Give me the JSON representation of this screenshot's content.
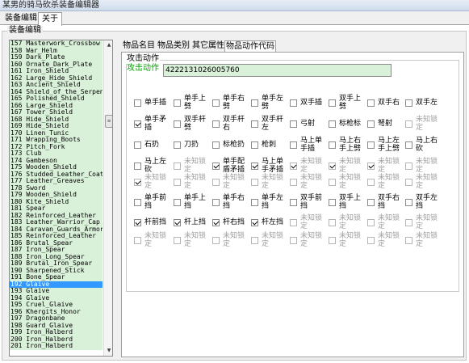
{
  "window": {
    "title": "某男的骑马砍杀装备编辑器"
  },
  "menu": {
    "items": [
      "装备编辑",
      "关于"
    ]
  },
  "equipment_group": {
    "label": "装备编辑"
  },
  "item_list": {
    "selected_index": 35,
    "items": [
      "157 Masterwork_Crossbow",
      "158 War_Helm",
      "159 Dark_Plate",
      "160 Ornate_Dark_Plate",
      "161 Iron_Shield",
      "162 Large_Hide_Shield",
      "163 Ancient_Shield",
      "164 Shield_of_the_Serpent",
      "165 Polished_Shield",
      "166 Large_Shield",
      "167 Tower_Shield",
      "168 Hide_Shield",
      "169 Hide_Shield",
      "170 Linen_Tunic",
      "171 Wrapping_Boots",
      "172 Pitch_Fork",
      "173 Club",
      "174 Gambeson",
      "175 Wooden_Shield",
      "176 Studded_Leather_Coat",
      "177 Leather_Greaves",
      "178 Sword",
      "179 Wooden_Shield",
      "180 Kite_Shield",
      "181 Spear",
      "182 Reinforced_Leather",
      "183 Leather_Warrior_Cap",
      "184 Caravan_Guards_Armor",
      "185 Reinforced_Leather",
      "186 Brutal_Spear",
      "187 Iron_Spear",
      "188 Iron_Long_Spear",
      "189 Brutal_Iron_Spear",
      "190 Sharpened_Stick",
      "191 Bone_Spear",
      "192 Glaive",
      "193 Glaive",
      "194 Glaive",
      "195 Cruel_Glaive",
      "196 Khergits_Honor",
      "197 Dragonbane",
      "198 Guard_Glaive",
      "199 Iron_Halberd",
      "200 Iron_Halberd",
      "201 Iron_Halberd"
    ]
  },
  "tabs": [
    "物品名目",
    "物品类别",
    "其它属性",
    "物品动作代码"
  ],
  "attack_group": {
    "label": "攻击动作"
  },
  "attack": {
    "label": "攻击动作",
    "code": "4222131026005760"
  },
  "checkbox_rows": [
    [
      {
        "label": "单手插",
        "checked": false,
        "disabled": false
      },
      {
        "label": "单手上劈",
        "checked": false,
        "disabled": false
      },
      {
        "label": "单手右劈",
        "checked": false,
        "disabled": false
      },
      {
        "label": "单手左劈",
        "checked": false,
        "disabled": false
      },
      {
        "label": "双手插",
        "checked": false,
        "disabled": false
      },
      {
        "label": "双手上劈",
        "checked": false,
        "disabled": false
      },
      {
        "label": "双手右",
        "checked": false,
        "disabled": false
      },
      {
        "label": "双手左",
        "checked": false,
        "disabled": false
      }
    ],
    [
      {
        "label": "单手矛插",
        "checked": true,
        "disabled": false
      },
      {
        "label": "双手杆劈",
        "checked": false,
        "disabled": false
      },
      {
        "label": "双手杆右",
        "checked": false,
        "disabled": false
      },
      {
        "label": "双手杆左",
        "checked": false,
        "disabled": false
      },
      {
        "label": "弓射",
        "checked": false,
        "disabled": false
      },
      {
        "label": "标枪标",
        "checked": false,
        "disabled": false
      },
      {
        "label": "弩射",
        "checked": false,
        "disabled": false
      },
      {
        "label": "未知锁定",
        "checked": false,
        "disabled": true
      }
    ],
    [
      {
        "label": "石扔",
        "checked": false,
        "disabled": false
      },
      {
        "label": "刀扔",
        "checked": false,
        "disabled": false
      },
      {
        "label": "标枪扔",
        "checked": false,
        "disabled": false
      },
      {
        "label": "枪刺",
        "checked": false,
        "disabled": false
      },
      {
        "label": "马上单手插",
        "checked": false,
        "disabled": false
      },
      {
        "label": "马上右手上劈",
        "checked": false,
        "disabled": false
      },
      {
        "label": "马上左手上劈",
        "checked": false,
        "disabled": false
      },
      {
        "label": "马上右砍",
        "checked": false,
        "disabled": false
      }
    ],
    [
      {
        "label": "马上左砍",
        "checked": false,
        "disabled": false
      },
      {
        "label": "未知锁定",
        "checked": false,
        "disabled": true
      },
      {
        "label": "单手配盾矛插",
        "checked": true,
        "disabled": false
      },
      {
        "label": "马上单手矛插",
        "checked": true,
        "disabled": false
      },
      {
        "label": "未知锁定",
        "checked": true,
        "disabled": true
      },
      {
        "label": "未知锁定",
        "checked": true,
        "disabled": true
      },
      {
        "label": "未知锁定",
        "checked": true,
        "disabled": true
      },
      {
        "label": "未知锁定",
        "checked": false,
        "disabled": true
      }
    ],
    [
      {
        "label": "未知锁定",
        "checked": true,
        "disabled": true
      },
      {
        "label": "未知锁定",
        "checked": false,
        "disabled": true
      },
      {
        "label": "未知锁定",
        "checked": false,
        "disabled": true
      },
      {
        "label": "未知锁定",
        "checked": false,
        "disabled": true
      },
      {
        "label": "未知锁定",
        "checked": false,
        "disabled": true
      },
      {
        "label": "未知锁定",
        "checked": false,
        "disabled": true
      },
      {
        "label": "未知锁定",
        "checked": false,
        "disabled": true
      },
      {
        "label": "未知锁定",
        "checked": false,
        "disabled": true
      }
    ],
    [
      {
        "label": "单手前挡",
        "checked": false,
        "disabled": false
      },
      {
        "label": "单手上挡",
        "checked": false,
        "disabled": false
      },
      {
        "label": "单手右挡",
        "checked": false,
        "disabled": false
      },
      {
        "label": "单手左挡",
        "checked": false,
        "disabled": false
      },
      {
        "label": "双手前挡",
        "checked": false,
        "disabled": false
      },
      {
        "label": "双手上挡",
        "checked": false,
        "disabled": false
      },
      {
        "label": "双手右挡",
        "checked": false,
        "disabled": false
      },
      {
        "label": "双手左挡",
        "checked": false,
        "disabled": false
      }
    ],
    [
      {
        "label": "杆前挡",
        "checked": true,
        "disabled": false
      },
      {
        "label": "杆上挡",
        "checked": true,
        "disabled": false
      },
      {
        "label": "杆右挡",
        "checked": true,
        "disabled": false
      },
      {
        "label": "杆左挡",
        "checked": true,
        "disabled": false
      },
      {
        "label": "未知锁定",
        "checked": false,
        "disabled": true
      },
      {
        "label": "未知锁定",
        "checked": false,
        "disabled": true
      },
      {
        "label": "未知锁定",
        "checked": false,
        "disabled": true
      },
      {
        "label": "未知锁定",
        "checked": false,
        "disabled": true
      }
    ],
    [
      {
        "label": "未知锁定",
        "checked": false,
        "disabled": true
      },
      {
        "label": "未知锁定",
        "checked": false,
        "disabled": true
      },
      {
        "label": "未知锁定",
        "checked": false,
        "disabled": true
      },
      {
        "label": "未知锁定",
        "checked": false,
        "disabled": true
      },
      {
        "label": "未知锁定",
        "checked": false,
        "disabled": true
      },
      {
        "label": "未知锁定",
        "checked": false,
        "disabled": true
      },
      {
        "label": "未知锁定",
        "checked": false,
        "disabled": true
      },
      {
        "label": "未知锁定",
        "checked": false,
        "disabled": true
      }
    ]
  ]
}
